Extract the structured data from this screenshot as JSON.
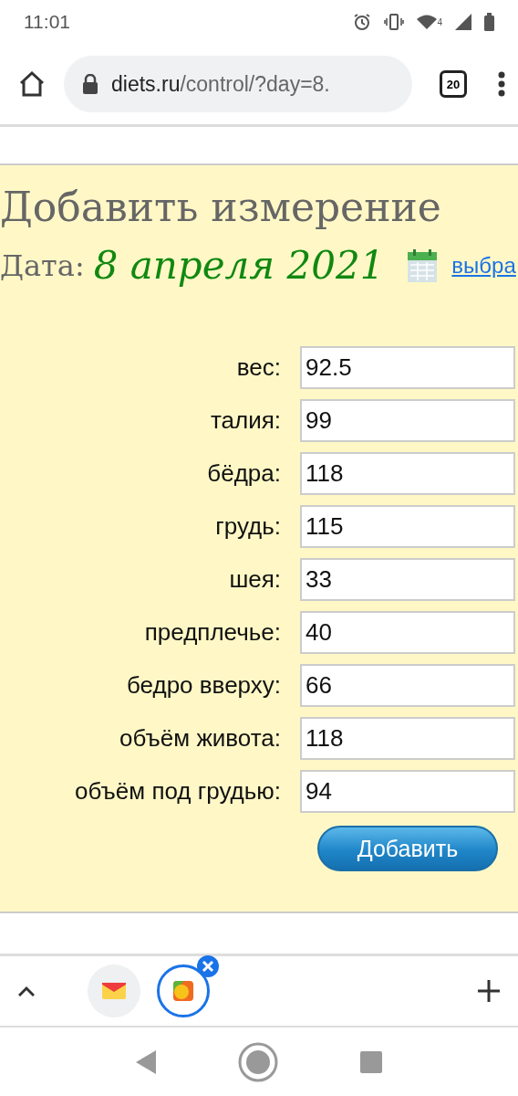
{
  "status_bar": {
    "time": "11:01",
    "wifi_label": "4"
  },
  "browser": {
    "url_host": "diets.ru",
    "url_path": "/control/?day=8.",
    "tab_count": "20"
  },
  "form": {
    "title": "Добавить измерение",
    "date_label": "Дата:",
    "date": "8 апреля 2021",
    "choose_link": "выбра",
    "fields": [
      {
        "label": "вес:",
        "value": "92.5"
      },
      {
        "label": "талия:",
        "value": "99"
      },
      {
        "label": "бёдра:",
        "value": "118"
      },
      {
        "label": "грудь:",
        "value": "115"
      },
      {
        "label": "шея:",
        "value": "33"
      },
      {
        "label": "предплечье:",
        "value": "40"
      },
      {
        "label": "бедро вверху:",
        "value": "66"
      },
      {
        "label": "объём живота:",
        "value": "118"
      },
      {
        "label": "объём под грудью:",
        "value": "94"
      }
    ],
    "submit": "Добавить"
  },
  "tab_strip": {
    "tabs": [
      {
        "kind": "mail",
        "selected": false
      },
      {
        "kind": "fruit",
        "selected": true
      }
    ]
  }
}
